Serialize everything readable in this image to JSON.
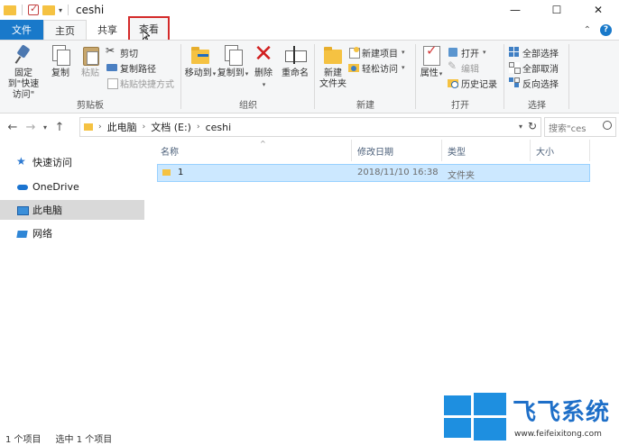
{
  "window": {
    "title": "ceshi",
    "controls": {
      "minimize": "—",
      "maximize": "☐",
      "close": "✕"
    }
  },
  "ribbon_tabs": {
    "file": "文件",
    "home": "主页",
    "share": "共享",
    "view": "查看",
    "collapse_glyph": "⌃"
  },
  "ribbon": {
    "clipboard": {
      "label": "剪贴板",
      "pin_to_quick": "固定到\"快速访问\"",
      "copy": "复制",
      "paste": "粘贴",
      "cut": "剪切",
      "copy_path": "复制路径",
      "paste_shortcut": "粘贴快捷方式"
    },
    "organize": {
      "label": "组织",
      "move_to": "移动到",
      "copy_to": "复制到",
      "delete": "删除",
      "rename": "重命名"
    },
    "new": {
      "label": "新建",
      "new_folder": "新建\n文件夹",
      "new_item": "新建项目",
      "easy_access": "轻松访问"
    },
    "open": {
      "label": "打开",
      "properties": "属性",
      "open": "打开",
      "edit": "编辑",
      "history": "历史记录"
    },
    "select": {
      "label": "选择",
      "select_all": "全部选择",
      "select_none": "全部取消",
      "invert": "反向选择"
    }
  },
  "address": {
    "crumbs": [
      "此电脑",
      "文档 (E:)",
      "ceshi"
    ],
    "search_placeholder": "搜索\"ces"
  },
  "sidebar": {
    "items": [
      {
        "label": "快速访问",
        "icon": "star-icon"
      },
      {
        "label": "OneDrive",
        "icon": "cloud-icon"
      },
      {
        "label": "此电脑",
        "icon": "pc-icon",
        "active": true
      },
      {
        "label": "网络",
        "icon": "network-icon"
      }
    ]
  },
  "filelist": {
    "columns": [
      "名称",
      "修改日期",
      "类型",
      "大小"
    ],
    "rows": [
      {
        "name": "1",
        "modified": "2018/11/10 16:38",
        "type": "文件夹",
        "size": ""
      }
    ]
  },
  "status": {
    "count": "1 个项目",
    "selected": "选中 1 个项目"
  },
  "watermark": {
    "brand": "飞飞系统",
    "url": "www.feifeixitong.com"
  },
  "colors": {
    "file_tab": "#1979ca",
    "highlight_box": "#d42a2a",
    "selection": "#cce8ff"
  }
}
